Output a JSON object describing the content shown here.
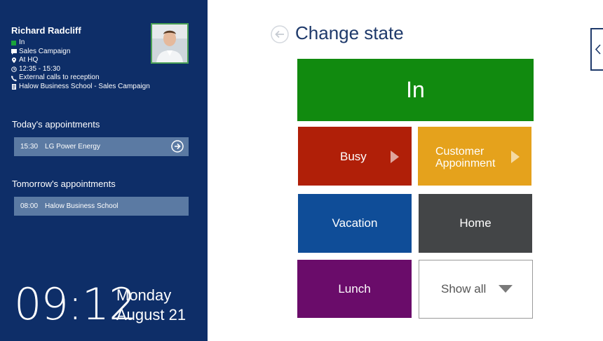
{
  "profile": {
    "name": "Richard Radcliff",
    "status": "In",
    "campaign": "Sales Campaign",
    "location": "At HQ",
    "hours": "12:35 - 15:30",
    "note": "External calls to reception",
    "organization": "Halow Business School - Sales Campaign",
    "status_color": "#1aa33b"
  },
  "appointments": {
    "today_heading": "Today's appointments",
    "today": [
      {
        "time": "15:30",
        "title": "LG Power Energy"
      }
    ],
    "tomorrow_heading": "Tomorrow's appointments",
    "tomorrow": [
      {
        "time": "08:00",
        "title": "Halow Business School"
      }
    ]
  },
  "clock": {
    "time": "09:12",
    "day": "Monday",
    "date": "August 21"
  },
  "main": {
    "title": "Change state",
    "tiles": {
      "in": "In",
      "busy": "Busy",
      "customer_line1": "Customer",
      "customer_line2": "Appoinment",
      "vacation": "Vacation",
      "home": "Home",
      "lunch": "Lunch",
      "show_all": "Show all"
    }
  },
  "colors": {
    "sidebar": "#0e2e68",
    "in": "#118a0f",
    "busy": "#b01f08",
    "customer": "#e5a21c",
    "vacation": "#0f4d98",
    "home": "#434547",
    "lunch": "#6a0c6a"
  },
  "icons": {
    "back": "arrow-left-circle-icon",
    "appointment_open": "arrow-right-circle-icon",
    "tile_expand": "play-icon",
    "show_all": "caret-down-icon",
    "edge": "chevron-left-icon"
  }
}
